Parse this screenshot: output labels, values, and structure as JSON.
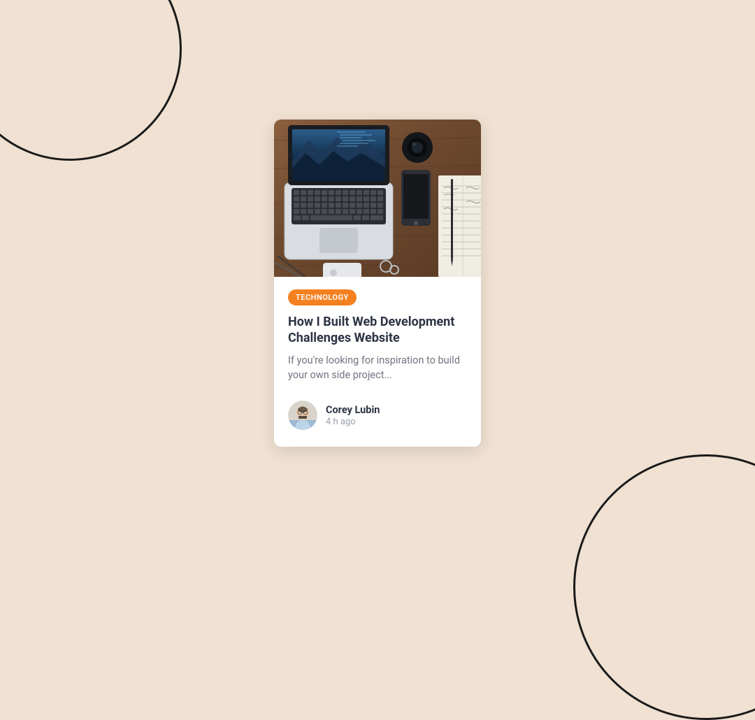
{
  "card": {
    "badge": "TECHNOLOGY",
    "title": "How I Built Web Development Challenges Website",
    "description": "If you're looking for inspiration to build your own side project...",
    "author": {
      "name": "Corey Lubin",
      "meta": "4 h ago"
    }
  },
  "colors": {
    "background": "#f0e1d2",
    "accent": "#f58020",
    "text_primary": "#2c3344",
    "text_secondary": "#6f7480"
  }
}
